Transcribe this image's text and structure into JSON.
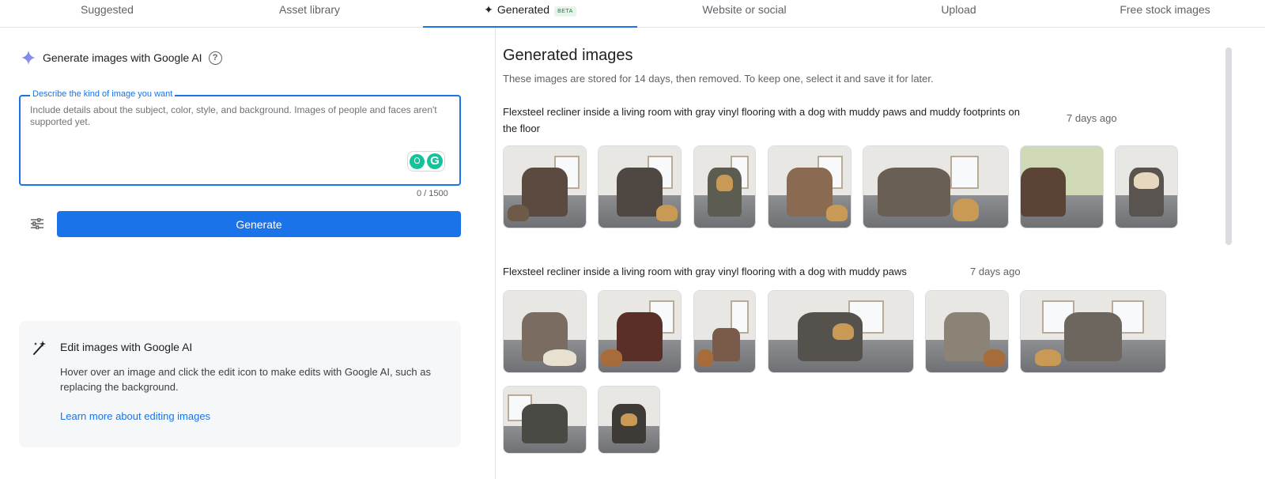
{
  "tabs": [
    {
      "label": "Suggested",
      "active": false
    },
    {
      "label": "Asset library",
      "active": false
    },
    {
      "label": "Generated",
      "active": true,
      "icon": "sparkle-icon",
      "badge": "BETA"
    },
    {
      "label": "Website or social",
      "active": false
    },
    {
      "label": "Upload",
      "active": false
    },
    {
      "label": "Free stock images",
      "active": false
    }
  ],
  "left": {
    "title": "Generate images with Google AI",
    "field_label": "Describe the kind of image you want",
    "placeholder": "Include details about the subject, color, style, and background. Images of people and faces aren't supported yet.",
    "value": "",
    "counter": "0 / 1500",
    "generate_label": "Generate",
    "edit_card": {
      "title": "Edit images with Google AI",
      "description": "Hover over an image and click the edit icon to make edits with Google AI, such as replacing the background.",
      "link": "Learn more about editing images"
    }
  },
  "right": {
    "title": "Generated images",
    "description": "These images are stored for 14 days, then removed. To keep one, select it and save it for later.",
    "groups": [
      {
        "prompt": "Flexsteel recliner inside a living room with gray vinyl flooring with a dog with muddy paws and muddy footprints on the floor",
        "time": "7 days ago",
        "image_count": 7
      },
      {
        "prompt": "Flexsteel recliner inside a living room with gray vinyl flooring with a dog with muddy paws",
        "time": "7 days ago",
        "image_count": 8
      }
    ]
  },
  "colors": {
    "accent": "#1a73e8",
    "text": "#202124",
    "muted": "#5f6368",
    "card_bg": "#f6f7f8"
  }
}
